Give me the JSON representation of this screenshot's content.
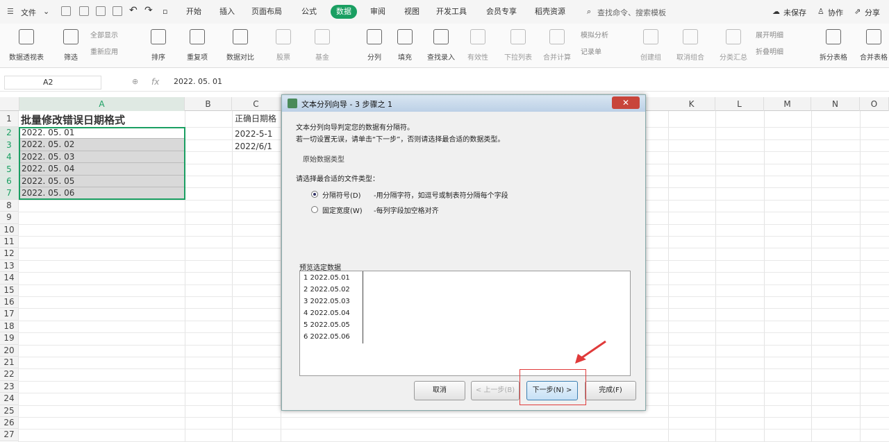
{
  "menubar": {
    "file": "文件",
    "tabs": [
      "开始",
      "插入",
      "页面布局",
      "公式",
      "数据",
      "审阅",
      "视图",
      "开发工具",
      "会员专享",
      "稻壳资源"
    ],
    "active_tab": "数据",
    "search": "查找命令、搜索模板",
    "save": "未保存",
    "collab": "协作",
    "share": "分享"
  },
  "ribbon": {
    "buttons": [
      "数据透视表",
      "筛选",
      "排序",
      "重复项",
      "数据对比",
      "股票",
      "基金",
      "分列",
      "填充",
      "查找录入",
      "有效性",
      "下拉列表",
      "合并计算",
      "创建组",
      "取消组合",
      "分类汇总",
      "拆分表格",
      "合并表格"
    ],
    "small": {
      "show_all": "全部显示",
      "reapply": "重新应用",
      "simulation": "模拟分析",
      "record": "记录单",
      "expand": "展开明细",
      "collapse": "折叠明细"
    }
  },
  "formula_bar": {
    "name_box": "A2",
    "fx": "fx",
    "value": "2022. 05. 01"
  },
  "columns": [
    "A",
    "B",
    "C",
    "K",
    "L",
    "M",
    "N",
    "O"
  ],
  "rows": [
    "1",
    "2",
    "3",
    "4",
    "5",
    "6",
    "7",
    "8",
    "9",
    "10",
    "11",
    "12",
    "13",
    "14",
    "15",
    "16",
    "17",
    "18",
    "19",
    "20",
    "21",
    "22",
    "23",
    "24",
    "25",
    "26",
    "27"
  ],
  "cells": {
    "a1": "批量修改错误日期格式",
    "a_values": [
      "2022. 05. 01",
      "2022. 05. 02",
      "2022. 05. 03",
      "2022. 05. 04",
      "2022. 05. 05",
      "2022. 05. 06"
    ],
    "c1": "正确日期格",
    "c2": "2022-5-1",
    "c3": "2022/6/1"
  },
  "dialog": {
    "title": "文本分列向导 - 3 步骤之 1",
    "close": "✕",
    "desc1": "文本分列向导判定您的数据有分隔符。",
    "desc2": "若一切设置无误，请单击“下一步”，否则请选择最合适的数据类型。",
    "group_title": "原始数据类型",
    "prompt": "请选择最合适的文件类型：",
    "opt1": "分隔符号(D)",
    "opt1_desc": "-用分隔字符，如逗号或制表符分隔每个字段",
    "opt2": "固定宽度(W)",
    "opt2_desc": "-每列字段加空格对齐",
    "preview_title": "预览选定数据",
    "preview_lines": [
      "1  2022.05.01",
      "2  2022.05.02",
      "3  2022.05.03",
      "4  2022.05.04",
      "5  2022.05.05",
      "6  2022.05.06"
    ],
    "btn_cancel": "取消",
    "btn_prev": "< 上一步(B)",
    "btn_next": "下一步(N) >",
    "btn_finish": "完成(F)"
  }
}
